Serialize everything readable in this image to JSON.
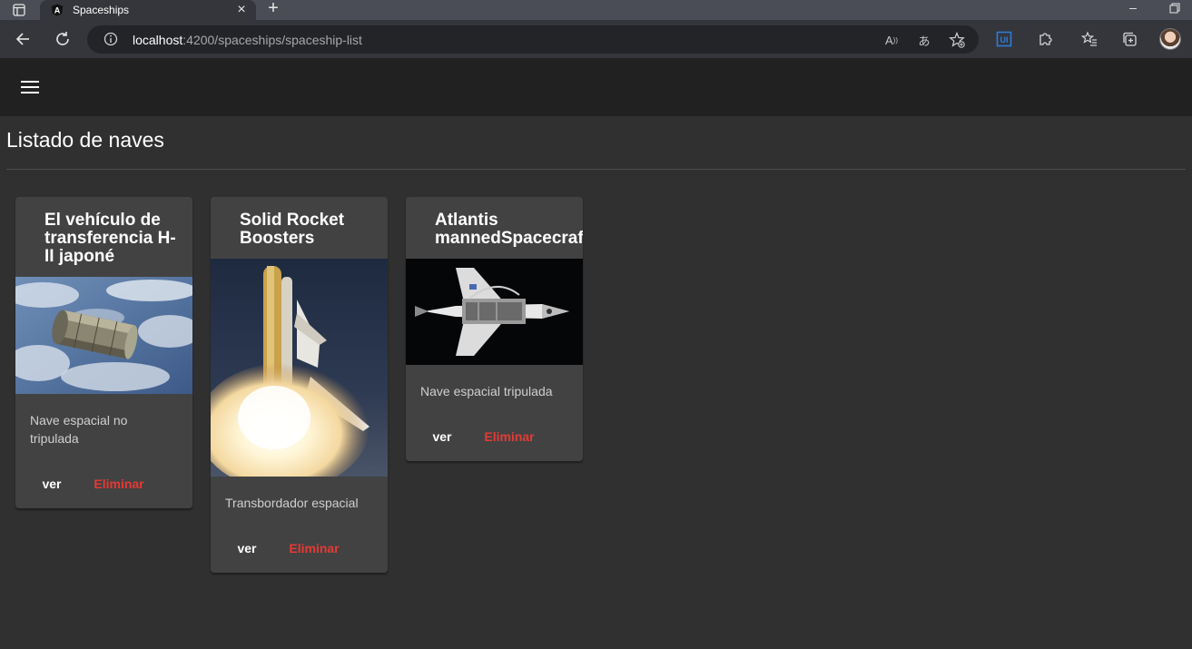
{
  "browser": {
    "tab_title": "Spaceships",
    "url_host": "localhost",
    "url_path": ":4200/spaceships/spaceship-list"
  },
  "page": {
    "title": "Listado de naves"
  },
  "cards": [
    {
      "title": "El vehículo de transferencia H-II japoné",
      "image_subject": "H-II transfer vehicle over Earth clouds",
      "description": "Nave espacial no tripulada",
      "view_label": "ver",
      "delete_label": "Eliminar"
    },
    {
      "title": "Solid Rocket Boosters",
      "image_subject": "Space shuttle launch with solid rocket boosters",
      "description": "Transbordador espacial",
      "view_label": "ver",
      "delete_label": "Eliminar"
    },
    {
      "title": "Atlantis mannedSpacecraft",
      "image_subject": "Atlantis orbiter in space with open payload bay",
      "description": "Nave espacial tripulada",
      "view_label": "ver",
      "delete_label": "Eliminar"
    }
  ],
  "colors": {
    "app_background": "#303030",
    "toolbar_background": "#212121",
    "card_background": "#424242",
    "delete_accent": "#e53935"
  }
}
